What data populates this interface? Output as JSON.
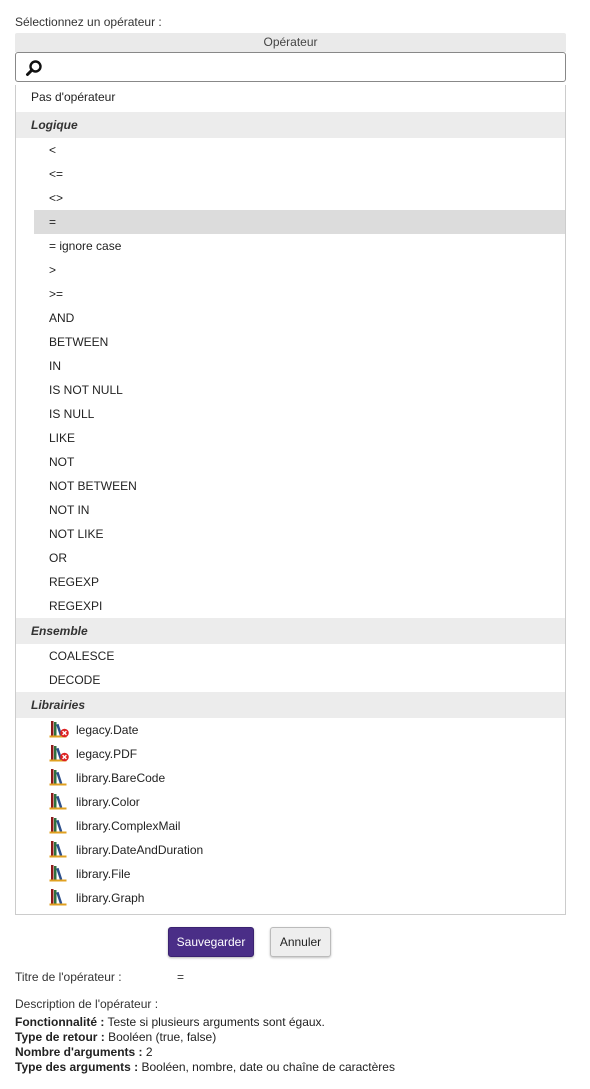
{
  "select_label": "Sélectionnez un opérateur :",
  "panel_header": "Opérateur",
  "search": {
    "value": "",
    "placeholder": ""
  },
  "no_operator": "Pas d'opérateur",
  "groups": {
    "logique": {
      "label": "Logique",
      "items": [
        "<",
        "<=",
        "<>",
        "=",
        "= ignore case",
        ">",
        ">=",
        "AND",
        "BETWEEN",
        "IN",
        "IS NOT NULL",
        "IS NULL",
        "LIKE",
        "NOT",
        "NOT BETWEEN",
        "NOT IN",
        "NOT LIKE",
        "OR",
        "REGEXP",
        "REGEXPI"
      ],
      "selected": "="
    },
    "ensemble": {
      "label": "Ensemble",
      "items": [
        "COALESCE",
        "DECODE"
      ]
    },
    "librairies": {
      "label": "Librairies",
      "items": [
        {
          "name": "legacy.Date",
          "icon": "library-deprecated-icon"
        },
        {
          "name": "legacy.PDF",
          "icon": "library-deprecated-icon"
        },
        {
          "name": "library.BareCode",
          "icon": "library-icon"
        },
        {
          "name": "library.Color",
          "icon": "library-icon"
        },
        {
          "name": "library.ComplexMail",
          "icon": "library-icon"
        },
        {
          "name": "library.DateAndDuration",
          "icon": "library-icon"
        },
        {
          "name": "library.File",
          "icon": "library-icon"
        },
        {
          "name": "library.Graph",
          "icon": "library-icon"
        }
      ]
    }
  },
  "buttons": {
    "save": "Sauvegarder",
    "cancel": "Annuler"
  },
  "operator_title": {
    "label": "Titre de l'opérateur :",
    "value": "="
  },
  "description": {
    "label": "Description de l'opérateur :",
    "lines": [
      {
        "key": "Fonctionnalité :",
        "value": " Teste si plusieurs arguments sont égaux."
      },
      {
        "key": "Type de retour :",
        "value": " Booléen (true, false)"
      },
      {
        "key": "Nombre d'arguments :",
        "value": " 2"
      },
      {
        "key": "Type des arguments :",
        "value": " Booléen, nombre, date ou chaîne de caractères"
      }
    ]
  },
  "colors": {
    "save_button": "#4a2e87",
    "group_bg": "#ececec",
    "selected_bg": "#dcdcdc"
  }
}
